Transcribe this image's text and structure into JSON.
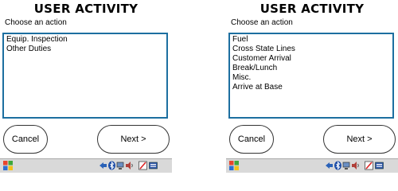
{
  "screens": [
    {
      "title": "USER ACTIVITY",
      "subtitle": "Choose an action",
      "items": [
        "Equip. Inspection",
        "Other Duties"
      ],
      "cancel_label": "Cancel",
      "next_label": "Next >"
    },
    {
      "title": "USER ACTIVITY",
      "subtitle": "Choose an action",
      "items": [
        "Fuel",
        "Cross State Lines",
        "Customer Arrival",
        "Break/Lunch",
        "Misc.",
        "Arrive at Base"
      ],
      "cancel_label": "Cancel",
      "next_label": "Next >"
    }
  ],
  "taskbar": {
    "icons": [
      "windows-start-icon",
      "sync-icon",
      "bluetooth-icon",
      "network-icon",
      "speaker-icon",
      "stylus-icon",
      "keyboard-icon"
    ]
  },
  "colors": {
    "list_border": "#1d6fa0",
    "taskbar": "#d9d9d9"
  }
}
